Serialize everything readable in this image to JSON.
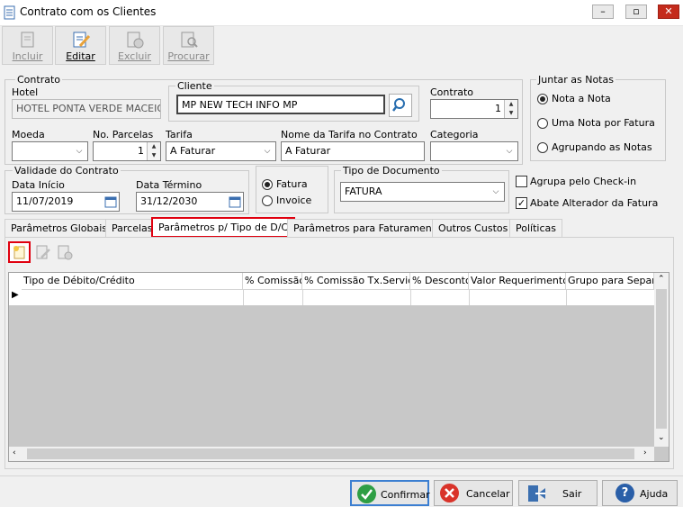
{
  "window": {
    "title": "Contrato com os Clientes"
  },
  "toolbar": {
    "incluir": "Incluir",
    "editar": "Editar",
    "excluir": "Excluir",
    "procurar": "Procurar"
  },
  "contrato_group": {
    "title": "Contrato",
    "hotel_label": "Hotel",
    "hotel_value": "HOTEL PONTA VERDE MACEIÓ",
    "cliente_title": "Cliente",
    "cliente_value": "MP NEW TECH INFO MP",
    "contrato_label": "Contrato",
    "contrato_value": "1",
    "moeda_label": "Moeda",
    "moeda_value": "",
    "parcelas_label": "No. Parcelas",
    "parcelas_value": "1",
    "tarifa_label": "Tarifa",
    "tarifa_value": "A Faturar",
    "nome_tarifa_label": "Nome da Tarifa no Contrato",
    "nome_tarifa_value": "A Faturar",
    "categoria_label": "Categoria",
    "categoria_value": ""
  },
  "juntar": {
    "title": "Juntar as Notas",
    "opt1": "Nota a Nota",
    "opt2": "Uma Nota por Fatura",
    "opt3": "Agrupando as Notas"
  },
  "validade": {
    "title": "Validade do Contrato",
    "inicio_label": "Data Início",
    "inicio_value": "11/07/2019",
    "termino_label": "Data Término",
    "termino_value": "31/12/2030"
  },
  "fatura_radio": {
    "fatura": "Fatura",
    "invoice": "Invoice"
  },
  "tipo_doc": {
    "title": "Tipo de Documento",
    "value": "FATURA"
  },
  "checks": {
    "agrupa": "Agrupa pelo Check-in",
    "abate": "Abate Alterador da Fatura"
  },
  "tabs": [
    "Parâmetros Globais",
    "Parcelas",
    "Parâmetros p/ Tipo de D/C",
    "Parâmetros para Faturamento",
    "Outros Custos",
    "Políticas"
  ],
  "grid": {
    "columns": [
      "Tipo de Débito/Crédito",
      "% Comissão",
      "% Comissão Tx.Serviço",
      "% Desconto",
      "Valor Requerimento",
      "Grupo para Separa"
    ]
  },
  "buttons": {
    "confirmar": "Confirmar",
    "cancelar": "Cancelar",
    "sair": "Sair",
    "ajuda": "Ajuda"
  },
  "colors": {
    "active_tab_border": "#e0000f",
    "confirm_icon": "#2e9e44",
    "cancel_icon": "#d9332a",
    "help_icon": "#2a5fa8"
  }
}
